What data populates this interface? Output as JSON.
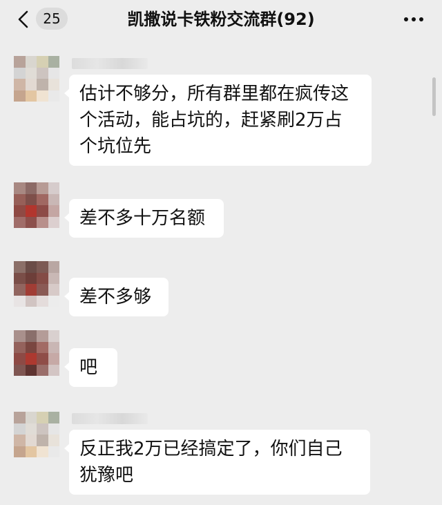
{
  "header": {
    "back_icon": "chevron-left-icon",
    "unread_count": "25",
    "title": "凯撒说卡铁粉交流群(92)",
    "more_icon": "more-dots-icon"
  },
  "messages": [
    {
      "text": "估计不够分，所有群里都在疯传这\n个活动，能占坑的，赶紧刷2万占\n个坑位先"
    },
    {
      "text": "差不多十万名额"
    },
    {
      "text": "差不多够"
    },
    {
      "text": "吧"
    },
    {
      "text": "反正我2万已经搞定了，你们自己\n犹豫吧"
    }
  ],
  "colors": {
    "background": "#ededed",
    "bubble": "#ffffff",
    "text": "#111111"
  }
}
